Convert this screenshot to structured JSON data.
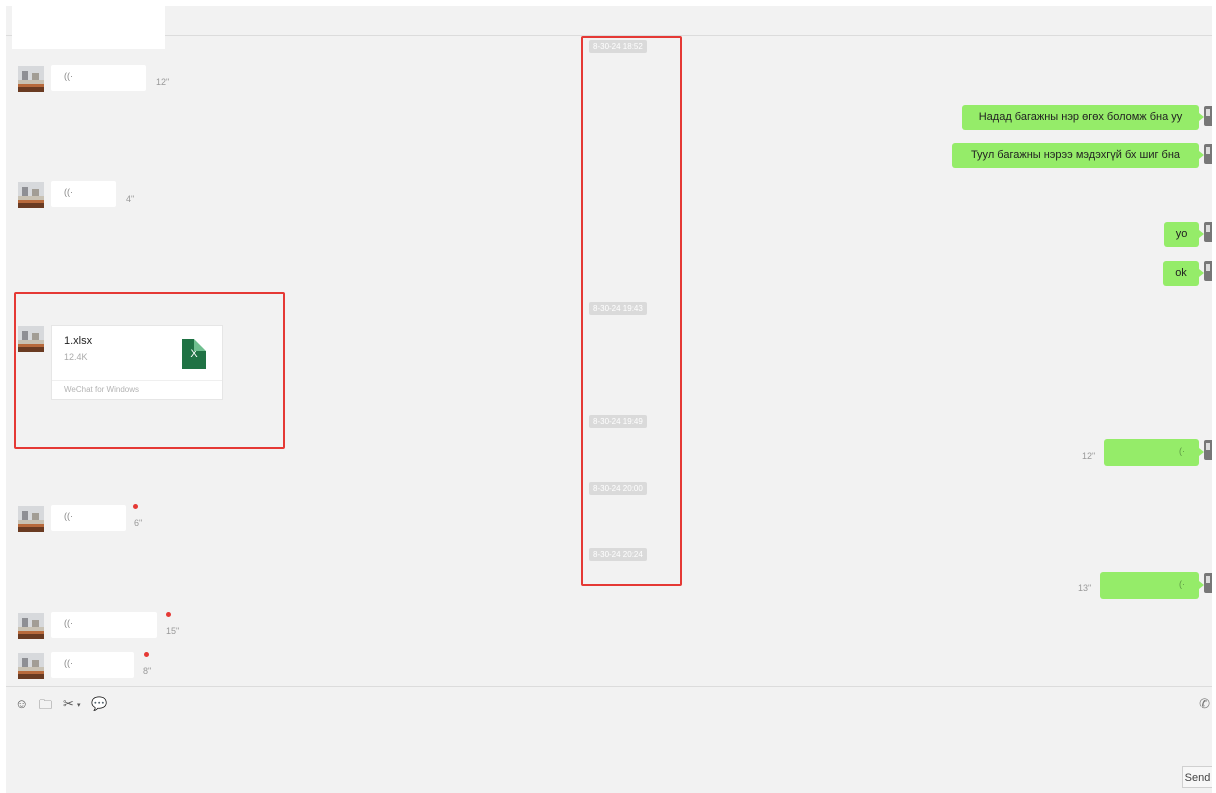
{
  "incoming": {
    "voice_1": {
      "duration": "12\""
    },
    "voice_2": {
      "duration": "4\""
    },
    "voice_3": {
      "duration": "6\""
    },
    "voice_4": {
      "duration": "15\""
    },
    "voice_5": {
      "duration": "8\""
    },
    "voice_icon": "((·",
    "file": {
      "name": "1.xlsx",
      "size": "12.4K",
      "icon_letter": "X",
      "source": "WeChat for Windows"
    }
  },
  "outgoing": {
    "msg_1": "Надад багажны нэр өгөх боломж бна уу",
    "msg_2": "Туул багажны нэрээ мэдэхгүй бх шиг бна",
    "msg_3": "yo",
    "msg_4": "ok",
    "voice_1": {
      "duration": "12\""
    },
    "voice_2": {
      "duration": "13\""
    },
    "voice_icon": "(·"
  },
  "timestamps": [
    "8-30-24 18:52",
    "8-30-24 19:43",
    "8-30-24 19:49",
    "8-30-24 20:00",
    "8-30-24 20:24"
  ],
  "toolbar": {
    "emoji_icon": "☺",
    "folder_icon": "🗀",
    "scissors_icon": "✂",
    "chat_icon": "💬",
    "phone_icon": "✆",
    "send_label": "Send"
  },
  "colors": {
    "outgoing_bubble": "#95ec69",
    "annotation_box": "#e53935",
    "unread_dot": "#e53935"
  }
}
